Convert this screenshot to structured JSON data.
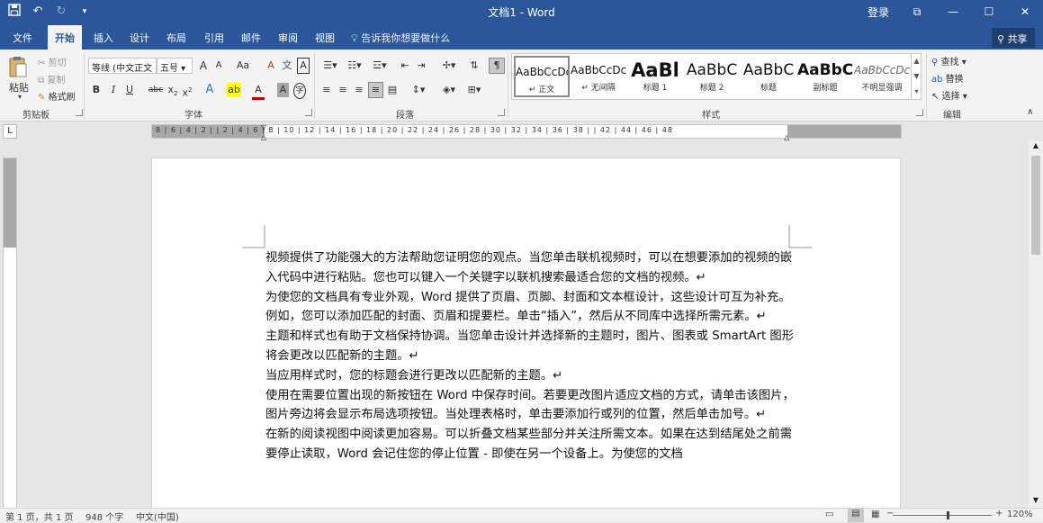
{
  "title_bar": {
    "document_title": "文档1 - Word",
    "login_label": "登录",
    "qat_icons": [
      "save-icon",
      "undo-icon",
      "redo-icon",
      "customize-qat-icon"
    ]
  },
  "tabs": {
    "file": "文件",
    "home": "开始",
    "insert": "插入",
    "design": "设计",
    "layout": "布局",
    "references": "引用",
    "mailings": "邮件",
    "review": "审阅",
    "view": "视图",
    "tell_me": "告诉我你想要做什么",
    "share": "共享"
  },
  "ribbon": {
    "clipboard": {
      "label": "剪贴板",
      "paste": "粘贴",
      "cut": "剪切",
      "copy": "复制",
      "format_painter": "格式刷"
    },
    "font": {
      "label": "字体",
      "font_name": "等线 (中文正文",
      "font_size": "五号",
      "grow": "A",
      "shrink": "A",
      "change_case": "Aa",
      "bold": "B",
      "italic": "I",
      "underline": "U",
      "strikethrough": "abc",
      "subscript": "x",
      "superscript": "x",
      "text_effects": "A",
      "highlight": "ab",
      "font_color": "A",
      "char_shading": "A",
      "enclose": "字",
      "phonetic": "文",
      "border": "A",
      "clear": "A"
    },
    "paragraph": {
      "label": "段落"
    },
    "styles": {
      "label": "样式",
      "items": [
        {
          "preview": "AaBbCcDc",
          "name": "↵ 正文"
        },
        {
          "preview": "AaBbCcDc",
          "name": "↵ 无间隔"
        },
        {
          "preview": "AaBl",
          "name": "标题 1"
        },
        {
          "preview": "AaBbC",
          "name": "标题 2"
        },
        {
          "preview": "AaBbC",
          "name": "标题"
        },
        {
          "preview": "AaBbC",
          "name": "副标题"
        },
        {
          "preview": "AaBbCcDc",
          "name": "不明显强调"
        }
      ]
    },
    "editing": {
      "label": "编辑",
      "find": "查找",
      "replace": "替换",
      "select": "选择"
    }
  },
  "ruler": {
    "h_labels": "8 | 6 | 4 | 2 |   | 2 | 4 | 6 | 8 | 10 | 12 | 14 | 16 | 18 | 20 | 22 | 24 | 26 | 28 | 30 | 32 | 34 | 36 | 38 |   | 42 | 44 | 46 | 48",
    "tab_selector": "L"
  },
  "document": {
    "paragraphs": [
      "视频提供了功能强大的方法帮助您证明您的观点。当您单击联机视频时，可以在想要添加的视频的嵌入代码中进行粘贴。您也可以键入一个关键字以联机搜索最适合您的文档的视频。↵",
      "为使您的文档具有专业外观，Word 提供了页眉、页脚、封面和文本框设计，这些设计可互为补充。例如，您可以添加匹配的封面、页眉和提要栏。单击“插入”，然后从不同库中选择所需元素。↵",
      "主题和样式也有助于文档保持协调。当您单击设计并选择新的主题时，图片、图表或 SmartArt 图形将会更改以匹配新的主题。↵",
      "当应用样式时，您的标题会进行更改以匹配新的主题。↵",
      "使用在需要位置出现的新按钮在 Word 中保存时间。若要更改图片适应文档的方式，请单击该图片，图片旁边将会显示布局选项按钮。当处理表格时，单击要添加行或列的位置，然后单击加号。↵",
      "在新的阅读视图中阅读更加容易。可以折叠文档某些部分并关注所需文本。如果在达到结尾处之前需要停止读取，Word 会记住您的停止位置 - 即使在另一个设备上。为使您的文档"
    ]
  },
  "status_bar": {
    "page": "第 1 页，共 1 页",
    "words": "948 个字",
    "language": "中文(中国)",
    "zoom": "120%",
    "zoom_level_percent": 120
  },
  "colors": {
    "accent": "#2b579a"
  }
}
